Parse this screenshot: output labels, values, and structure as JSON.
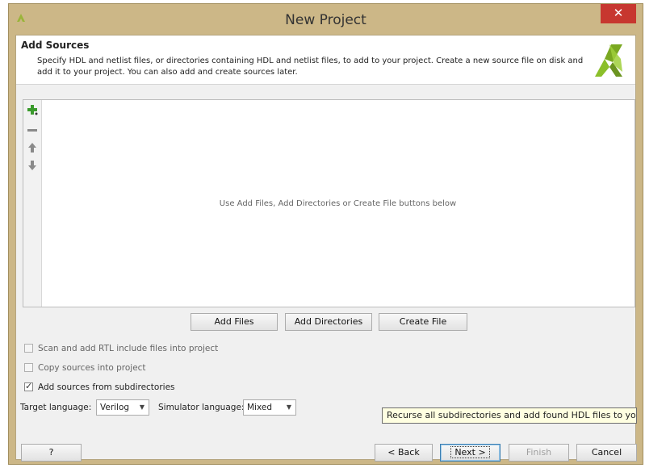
{
  "window": {
    "title": "New Project",
    "close_symbol": "✕"
  },
  "header": {
    "title": "Add Sources",
    "description": "Specify HDL and netlist files, or directories containing HDL and netlist files, to add to your project. Create a new source file on disk and add it to your project. You can also add and create sources later."
  },
  "sources_panel": {
    "toolbar": [
      "add-icon",
      "remove-icon",
      "move-up-icon",
      "move-down-icon"
    ],
    "empty_message": "Use Add Files, Add Directories or Create File buttons below"
  },
  "actions": {
    "add_files": "Add Files",
    "add_directories": "Add Directories",
    "create_file": "Create File"
  },
  "options": {
    "scan_rtl": {
      "label": "Scan and add RTL include files into project",
      "checked": false,
      "enabled": false
    },
    "copy_sources": {
      "label": "Copy sources into project",
      "checked": false,
      "enabled": false
    },
    "add_subdirs": {
      "label": "Add sources from subdirectories",
      "checked": true,
      "enabled": true
    }
  },
  "language": {
    "target_label": "Target language:",
    "target_value": "Verilog",
    "simulator_label": "Simulator language:",
    "simulator_value": "Mixed"
  },
  "tooltip": "Recurse all subdirectories and add found HDL files to your",
  "footer": {
    "help": "?",
    "back": "< Back",
    "next": "Next >",
    "finish": "Finish",
    "cancel": "Cancel"
  },
  "colors": {
    "frame": "#ccb787",
    "close": "#c7372f",
    "logo_green": "#8bbf2a",
    "add_green": "#3a9a2c",
    "tooltip_bg": "#ffffe1"
  }
}
